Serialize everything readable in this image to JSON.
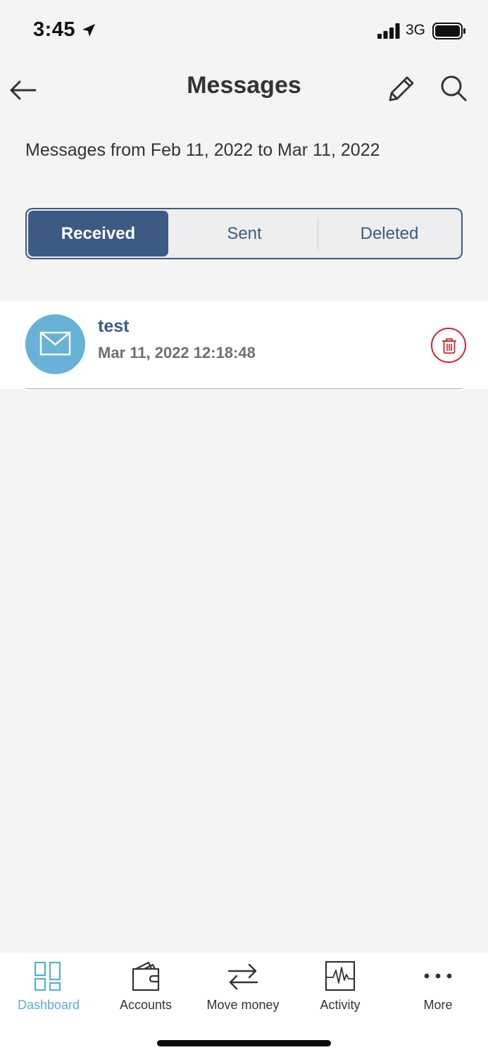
{
  "status_bar": {
    "time": "3:45",
    "network": "3G"
  },
  "header": {
    "title": "Messages"
  },
  "date_range": "Messages from Feb 11, 2022 to Mar 11, 2022",
  "segments": {
    "received": "Received",
    "sent": "Sent",
    "deleted": "Deleted",
    "selected": "Received"
  },
  "messages": [
    {
      "subject": "test",
      "date": "Mar 11, 2022 12:18:48",
      "icon": "envelope-icon"
    }
  ],
  "tabs": [
    {
      "label": "Dashboard",
      "icon": "dashboard-icon",
      "active": true
    },
    {
      "label": "Accounts",
      "icon": "wallet-icon",
      "active": false
    },
    {
      "label": "Move money",
      "icon": "transfer-arrows-icon",
      "active": false
    },
    {
      "label": "Activity",
      "icon": "activity-chart-icon",
      "active": false
    },
    {
      "label": "More",
      "icon": "more-dots-icon",
      "active": false
    }
  ],
  "colors": {
    "primary": "#3d5a85",
    "accent": "#67b2d6",
    "active_tab": "#5aaed6",
    "danger": "#c9262c",
    "background": "#f4f4f4"
  }
}
